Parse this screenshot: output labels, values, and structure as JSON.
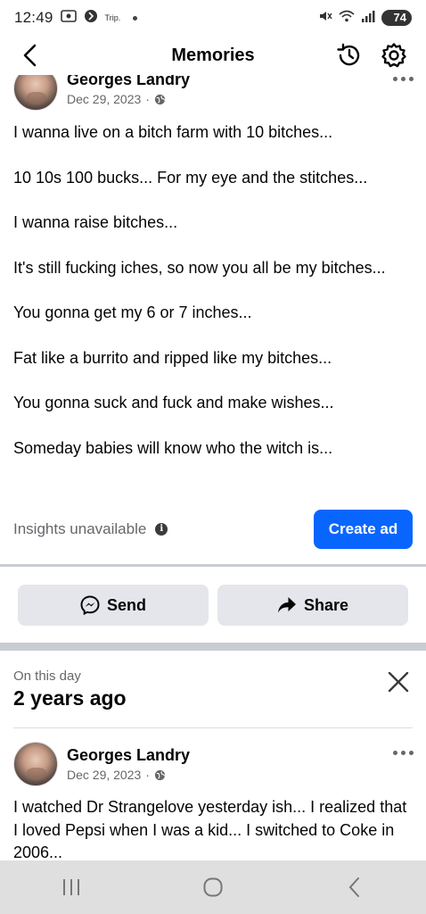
{
  "status_bar": {
    "time": "12:49",
    "notification_text": "Trip.",
    "battery": "74"
  },
  "header": {
    "title": "Memories"
  },
  "post1": {
    "author": "Georges Landry",
    "date": "Dec 29, 2023",
    "separator": "·",
    "lines": [
      "I wanna live on a bitch farm with 10 bitches...",
      "10 10s 100 bucks... For my eye and the stitches...",
      "I wanna raise bitches...",
      "It's still fucking iches, so now you all be my bitches...",
      "You gonna get my 6 or 7 inches...",
      "Fat like a burrito and ripped like my bitches...",
      "You gonna suck and fuck and make wishes...",
      "Someday babies will know who the witch is..."
    ],
    "insights": "Insights unavailable",
    "create_ad": "Create ad"
  },
  "actions": {
    "send": "Send",
    "share": "Share"
  },
  "on_this_day": {
    "label": "On this day",
    "title": "2 years ago"
  },
  "post2": {
    "author": "Georges Landry",
    "date": "Dec 29, 2023",
    "separator": "·",
    "text": "I watched Dr Strangelove yesterday ish... I realized that I loved Pepsi when I was a kid... I switched to Coke in 2006..."
  },
  "colors": {
    "accent": "#0866ff",
    "button_bg": "#e4e6eb",
    "secondary_text": "#65676b",
    "divider": "#c9ccd1"
  }
}
